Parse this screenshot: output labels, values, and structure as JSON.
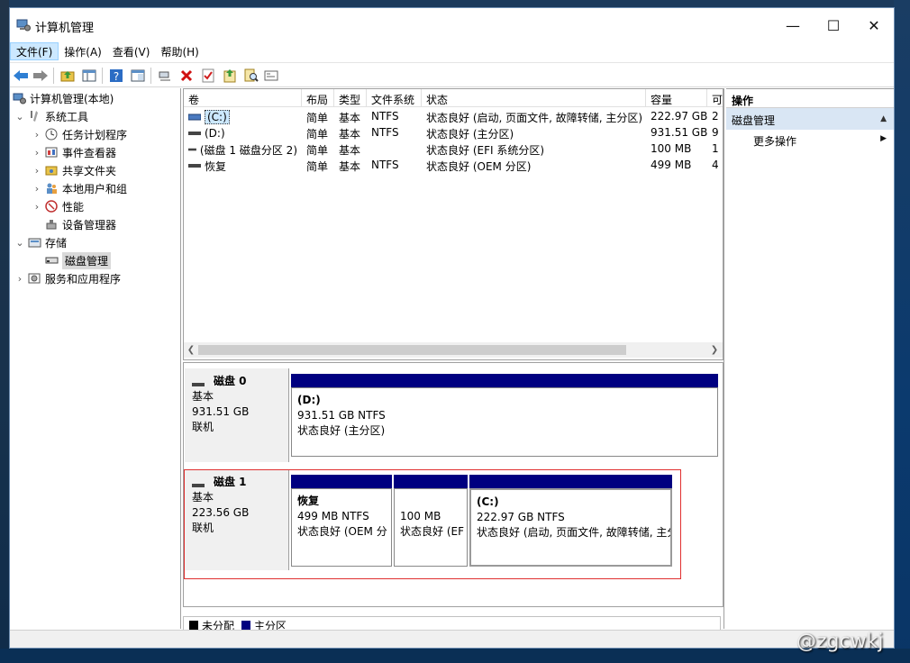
{
  "window": {
    "title": "计算机管理",
    "minimize": "—",
    "maximize": "☐",
    "close": "✕"
  },
  "menu": [
    "文件(F)",
    "操作(A)",
    "查看(V)",
    "帮助(H)"
  ],
  "toolbar_icons": [
    "back-arrow-icon",
    "forward-arrow-icon",
    "up-folder-icon",
    "show-hide-tree-icon",
    "help-icon",
    "properties-icon",
    "connect-icon",
    "delete-icon",
    "check-icon",
    "export-icon",
    "search-icon",
    "console-icon"
  ],
  "tree": {
    "root": "计算机管理(本地)",
    "system_tools": "系统工具",
    "task_scheduler": "任务计划程序",
    "event_viewer": "事件查看器",
    "shared_folders": "共享文件夹",
    "local_users": "本地用户和组",
    "performance": "性能",
    "device_manager": "设备管理器",
    "storage": "存储",
    "disk_management": "磁盘管理",
    "services": "服务和应用程序"
  },
  "volumes": {
    "headers": [
      "卷",
      "布局",
      "类型",
      "文件系统",
      "状态",
      "容量",
      "可"
    ],
    "rows": [
      {
        "vol": "(C:)",
        "layout": "简单",
        "type": "基本",
        "fs": "NTFS",
        "status": "状态良好 (启动, 页面文件, 故障转储, 主分区)",
        "size": "222.97 GB",
        "free": "2"
      },
      {
        "vol": "(D:)",
        "layout": "简单",
        "type": "基本",
        "fs": "NTFS",
        "status": "状态良好 (主分区)",
        "size": "931.51 GB",
        "free": "9"
      },
      {
        "vol": "(磁盘 1 磁盘分区 2)",
        "layout": "简单",
        "type": "基本",
        "fs": "",
        "status": "状态良好 (EFI 系统分区)",
        "size": "100 MB",
        "free": "1"
      },
      {
        "vol": "恢复",
        "layout": "简单",
        "type": "基本",
        "fs": "NTFS",
        "status": "状态良好 (OEM 分区)",
        "size": "499 MB",
        "free": "4"
      }
    ]
  },
  "disks": [
    {
      "name": "磁盘 0",
      "type": "基本",
      "size": "931.51 GB",
      "state": "联机",
      "partitions": [
        {
          "name": "(D:)",
          "size": "931.51 GB NTFS",
          "status": "状态良好 (主分区)"
        }
      ]
    },
    {
      "name": "磁盘 1",
      "type": "基本",
      "size": "223.56 GB",
      "state": "联机",
      "partitions": [
        {
          "name": "恢复",
          "size": "499 MB NTFS",
          "status": "状态良好 (OEM 分"
        },
        {
          "name": "",
          "size": "100 MB",
          "status": "状态良好 (EF"
        },
        {
          "name": "(C:)",
          "size": "222.97 GB NTFS",
          "status": "状态良好 (启动, 页面文件, 故障转储, 主分"
        }
      ]
    }
  ],
  "legend": {
    "unallocated": "未分配",
    "primary": "主分区",
    "unallocated_color": "#000000",
    "primary_color": "#000080"
  },
  "actions": {
    "header": "操作",
    "group": "磁盘管理",
    "more": "更多操作"
  },
  "watermark": "@zgcwkj",
  "colors": {
    "partition_bar": "#000080",
    "selection_border": "#e03030",
    "group_bg": "#d9e6f4"
  }
}
